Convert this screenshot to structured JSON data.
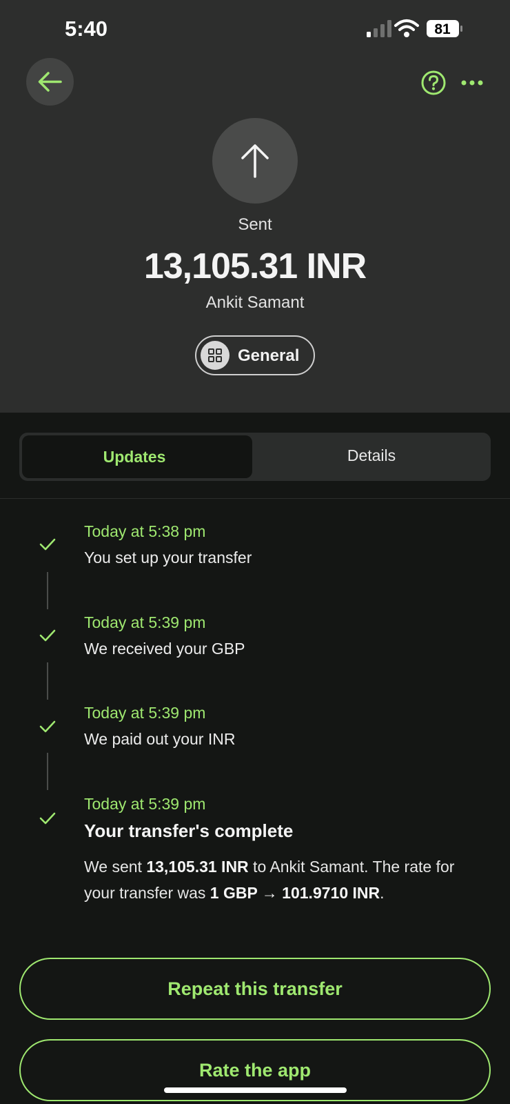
{
  "status_bar": {
    "time": "5:40",
    "battery": "81"
  },
  "header": {
    "back_icon": "arrow-left-icon",
    "help_icon": "question-circle-icon",
    "more_icon": "more-dots-icon"
  },
  "summary": {
    "icon": "arrow-up-icon",
    "status": "Sent",
    "amount": "13,105.31 INR",
    "recipient": "Ankit Samant",
    "category_label": "General",
    "category_icon": "grid-icon"
  },
  "tabs": [
    {
      "label": "Updates",
      "active": true
    },
    {
      "label": "Details",
      "active": false
    }
  ],
  "timeline": [
    {
      "time": "Today at 5:38 pm",
      "event": "You set up your transfer"
    },
    {
      "time": "Today at 5:39 pm",
      "event": "We received your GBP"
    },
    {
      "time": "Today at 5:39 pm",
      "event": "We paid out your INR"
    },
    {
      "time": "Today at 5:39 pm",
      "event": "Your transfer's complete"
    }
  ],
  "completion": {
    "p1": "We sent ",
    "amount": "13,105.31 INR",
    "p2": " to Ankit Samant. The rate for your transfer was ",
    "rate": "1 GBP → 101.9710 INR",
    "p3": "."
  },
  "actions": {
    "repeat_label": "Repeat this transfer",
    "rate_label": "Rate the app"
  },
  "colors": {
    "accent": "#9fe870",
    "header_bg": "#2d2e2d",
    "body_bg": "#141614"
  }
}
